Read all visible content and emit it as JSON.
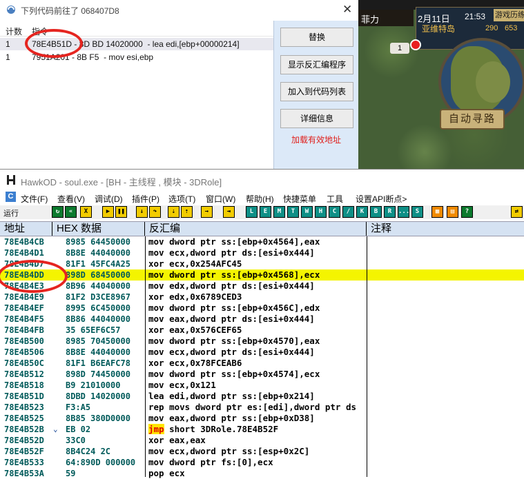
{
  "dialog": {
    "title": "下列代码前往了 068407D8",
    "close_glyph": "✕",
    "headers": [
      "计数",
      "指令"
    ],
    "rows": [
      {
        "count": "1",
        "instr": "78E4B51D - 8D BD 14020000  - lea edi,[ebp+00000214]"
      },
      {
        "count": "1",
        "instr": "7951A201 - 8B F5  - mov esi,ebp"
      }
    ],
    "buttons": [
      "替换",
      "显示反汇编程序",
      "加入到代码列表",
      "详细信息"
    ],
    "link": "加载有效地址",
    "accent_color": "#e52520"
  },
  "game": {
    "name": "菲力",
    "date": "2月11日",
    "clock": "21:53",
    "button": "游戏历练",
    "map_name": "亚维特岛",
    "coord_x": "290",
    "coord_y": "653",
    "pl_button": "1",
    "auto_path": "自动寻路"
  },
  "debugger": {
    "title": "HawkOD  - soul.exe - [BH - 主线程 , 模块 - 3DRole]",
    "menu": [
      "文件(F)",
      "查看(V)",
      "调试(D)",
      "插件(P)",
      "选项(T)",
      "窗口(W)",
      "帮助(H)",
      "快捷菜单",
      "工具",
      "设置API断点>"
    ],
    "toolbar_label": "运行",
    "toolbar_letters": [
      "L",
      "E",
      "M",
      "T",
      "W",
      "H",
      "C",
      "/",
      "K",
      "B",
      "R",
      "...",
      "S"
    ],
    "columns": {
      "addr": "地址",
      "hex": "HEX 数据",
      "dis": "反汇编",
      "cmt": "注释"
    },
    "rows": [
      {
        "addr": "78E4B4CB",
        "hex": "8985 64450000",
        "mn": "mov dword ptr ss:[ebp+0x4564],eax",
        "hl": false
      },
      {
        "addr": "78E4B4D1",
        "hex": "8B8E 44040000",
        "mn": "mov ecx,dword ptr ds:[esi+0x444]",
        "hl": false
      },
      {
        "addr": "78E4B4D7",
        "hex": "81F1 45FC4A25",
        "mn": "xor ecx,0x254AFC45",
        "hl": false
      },
      {
        "addr": "78E4B4DD",
        "hex": "898D 68450000",
        "mn": "mov dword ptr ss:[ebp+0x4568],ecx",
        "hl": true
      },
      {
        "addr": "78E4B4E3",
        "hex": "8B96 44040000",
        "mn": "mov edx,dword ptr ds:[esi+0x444]",
        "hl": false
      },
      {
        "addr": "78E4B4E9",
        "hex": "81F2 D3CE8967",
        "mn": "xor edx,0x6789CED3",
        "hl": false
      },
      {
        "addr": "78E4B4EF",
        "hex": "8995 6C450000",
        "mn": "mov dword ptr ss:[ebp+0x456C],edx",
        "hl": false
      },
      {
        "addr": "78E4B4F5",
        "hex": "8B86 44040000",
        "mn": "mov eax,dword ptr ds:[esi+0x444]",
        "hl": false
      },
      {
        "addr": "78E4B4FB",
        "hex": "35 65EF6C57",
        "mn": "xor eax,0x576CEF65",
        "hl": false
      },
      {
        "addr": "78E4B500",
        "hex": "8985 70450000",
        "mn": "mov dword ptr ss:[ebp+0x4570],eax",
        "hl": false
      },
      {
        "addr": "78E4B506",
        "hex": "8B8E 44040000",
        "mn": "mov ecx,dword ptr ds:[esi+0x444]",
        "hl": false
      },
      {
        "addr": "78E4B50C",
        "hex": "81F1 B6EAFC78",
        "mn": "xor ecx,0x78FCEAB6",
        "hl": false
      },
      {
        "addr": "78E4B512",
        "hex": "898D 74450000",
        "mn": "mov dword ptr ss:[ebp+0x4574],ecx",
        "hl": false
      },
      {
        "addr": "78E4B518",
        "hex": "B9 21010000",
        "mn": "mov ecx,0x121",
        "hl": false
      },
      {
        "addr": "78E4B51D",
        "hex": "8DBD 14020000",
        "mn": "lea edi,dword ptr ss:[ebp+0x214]",
        "hl": false
      },
      {
        "addr": "78E4B523",
        "hex": "F3:A5",
        "mn": "rep movs dword ptr es:[edi],dword ptr ds",
        "hl": false
      },
      {
        "addr": "78E4B525",
        "hex": "8B85 380D0000",
        "mn": "mov eax,dword ptr ss:[ebp+0xD38]",
        "hl": false
      },
      {
        "addr": "78E4B52B",
        "hex": "EB 02",
        "mn": "short 3DRole.78E4B52F",
        "jmp": "jmp",
        "arrow": "⌄",
        "hl": false
      },
      {
        "addr": "78E4B52D",
        "hex": "33C0",
        "mn": "xor eax,eax",
        "hl": false
      },
      {
        "addr": "78E4B52F",
        "hex": "8B4C24 2C",
        "mn": "mov ecx,dword ptr ss:[esp+0x2C]",
        "hl": false
      },
      {
        "addr": "78E4B533",
        "hex": "64:890D 000000",
        "mn": "mov dword ptr fs:[0],ecx",
        "hl": false
      },
      {
        "addr": "78E4B53A",
        "hex": "59",
        "mn": "pop ecx",
        "hl": false
      }
    ],
    "highlight_color": "#f4f400",
    "text_color": "#005a5a"
  }
}
